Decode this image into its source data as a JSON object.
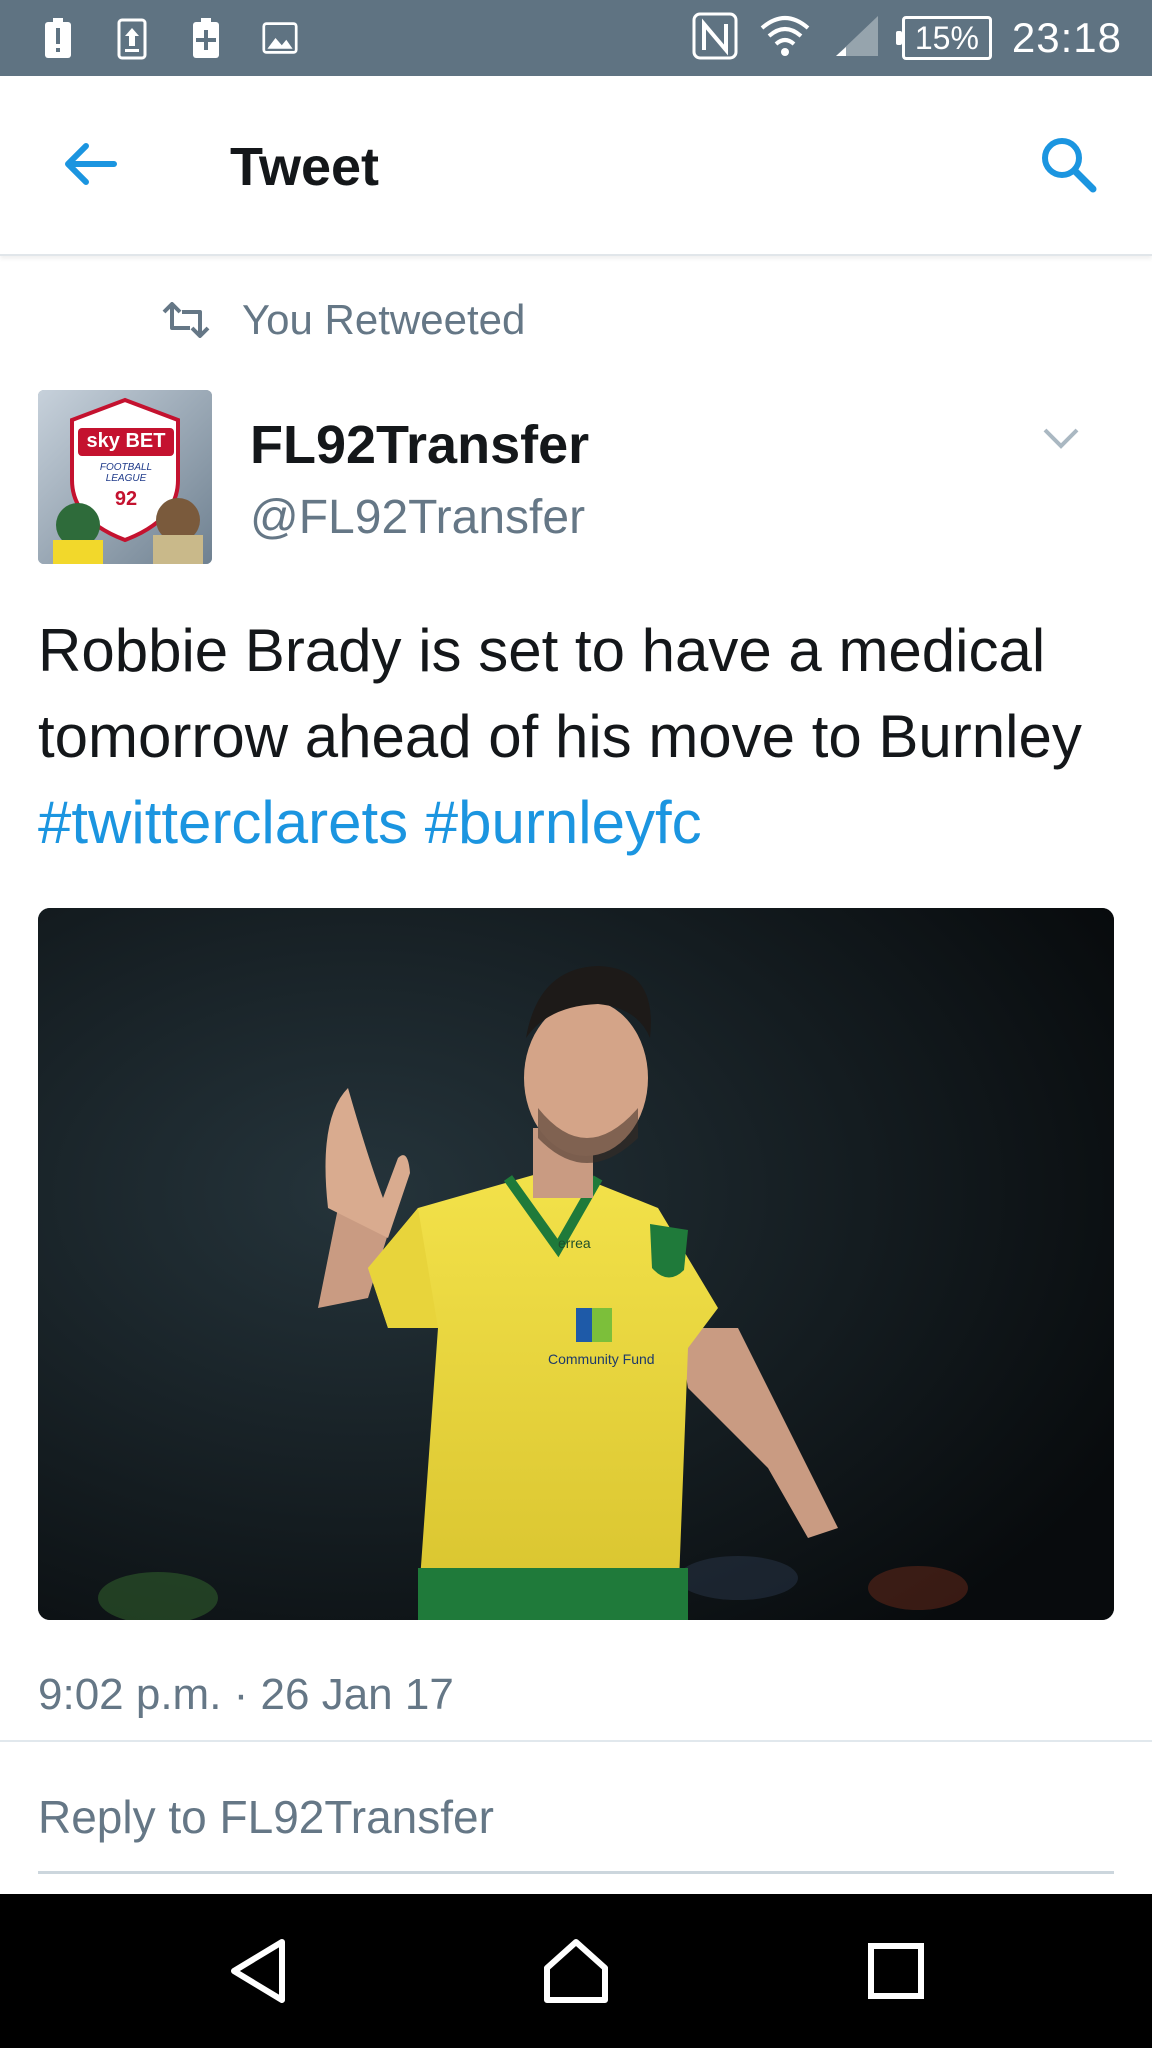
{
  "status_bar": {
    "battery_text": "15%",
    "time": "23:18",
    "icons": [
      "alert-icon",
      "upload-icon",
      "battery-saver-icon",
      "gallery-icon",
      "nfc-icon",
      "wifi-icon",
      "signal-icon",
      "battery-icon"
    ]
  },
  "app_bar": {
    "title": "Tweet",
    "back_icon": "back-arrow-icon",
    "search_icon": "search-icon",
    "accent_color": "#1b95e0"
  },
  "retweet_context": {
    "label": "You Retweeted",
    "icon": "retweet-icon"
  },
  "author": {
    "display_name": "FL92Transfer",
    "handle": "@FL92Transfer",
    "avatar_text": "sky BET",
    "avatar_subtext": "FOOTBALL LEAGUE",
    "avatar_number": "92"
  },
  "tweet": {
    "text": "Robbie Brady is set to have a medical tomorrow ahead of his move to Burnley ",
    "hashtags": [
      "#twitterclarets",
      "#burnleyfc"
    ],
    "media": {
      "kit_sponsor": "errea",
      "shirt_text": "Community Fund"
    },
    "timestamp": "9:02 p.m. · 26 Jan 17"
  },
  "reply": {
    "placeholder": "Reply to FL92Transfer"
  },
  "nav_bar": {
    "icons": [
      "back-triangle-icon",
      "home-icon",
      "recents-icon"
    ]
  }
}
